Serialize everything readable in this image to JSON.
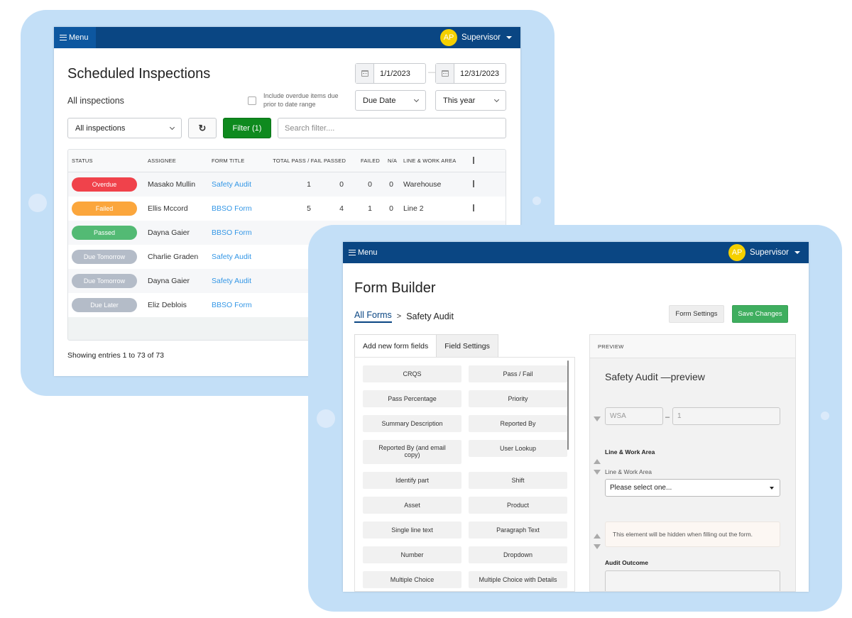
{
  "colors": {
    "frame": "#c3dff7",
    "topbar": "#0a4683",
    "avatar": "#f5d000",
    "link": "#3497e6",
    "filter_button": "#0e8a1e",
    "save_button": "#3fae5f"
  },
  "inspections_screen": {
    "topbar": {
      "menu_icon": "hamburger-icon",
      "menu_label": "Menu",
      "avatar_initials": "AP",
      "user_label": "Supervisor",
      "user_caret_icon": "caret-down-icon"
    },
    "title": "Scheduled Inspections",
    "subtitle": "All inspections",
    "date_range": {
      "start": "1/1/2023",
      "separator": "—",
      "end": "12/31/2023",
      "icon": "calendar-icon"
    },
    "include_overdue": {
      "checked": false,
      "label_line1": "Include overdue items due",
      "label_line2": "prior to date range"
    },
    "date_field_select": "Due Date",
    "period_select": "This year",
    "view_select": "All inspections",
    "refresh_icon": "refresh-icon",
    "filter_label": "Filter (1)",
    "search_placeholder": "Search filter....",
    "table": {
      "columns": [
        "STATUS",
        "ASSIGNEE",
        "FORM TITLE",
        "TOTAL PASS / FAIL",
        "PASSED",
        "FAILED",
        "N/A",
        "LINE & WORK AREA"
      ],
      "rows": [
        {
          "status": "Overdue",
          "status_color": "#f0424b",
          "assignee": "Masako Mullin",
          "form": "Safety Audit",
          "total": "1",
          "passed": "0",
          "failed": "0",
          "na": "0",
          "line": "Warehouse"
        },
        {
          "status": "Failed",
          "status_color": "#fba63c",
          "assignee": "Ellis Mccord",
          "form": "BBSO Form",
          "total": "5",
          "passed": "4",
          "failed": "1",
          "na": "0",
          "line": "Line 2"
        },
        {
          "status": "Passed",
          "status_color": "#53ba74",
          "assignee": "Dayna Gaier",
          "form": "BBSO Form",
          "total": "",
          "passed": "",
          "failed": "",
          "na": "",
          "line": ""
        },
        {
          "status": "Due Tomorrow",
          "status_color": "#b4bcc8",
          "assignee": "Charlie Graden",
          "form": "Safety Audit",
          "total": "",
          "passed": "",
          "failed": "",
          "na": "",
          "line": ""
        },
        {
          "status": "Due Tomorrow",
          "status_color": "#b4bcc8",
          "assignee": "Dayna Gaier",
          "form": "Safety Audit",
          "total": "",
          "passed": "",
          "failed": "",
          "na": "",
          "line": ""
        },
        {
          "status": "Due Later",
          "status_color": "#b4bcc8",
          "assignee": "Eliz Deblois",
          "form": "BBSO Form",
          "total": "",
          "passed": "",
          "failed": "",
          "na": "",
          "line": ""
        }
      ]
    },
    "footer": "Showing entries 1 to 73 of 73"
  },
  "form_builder_screen": {
    "topbar": {
      "menu_label": "Menu",
      "avatar_initials": "AP",
      "user_label": "Supervisor"
    },
    "title": "Form Builder",
    "breadcrumb": {
      "root": "All Forms",
      "separator": ">",
      "current": "Safety Audit"
    },
    "form_settings_label": "Form Settings",
    "save_label": "Save Changes",
    "tabs": [
      {
        "label": "Add new form fields",
        "active": true
      },
      {
        "label": "Field Settings",
        "active": false
      }
    ],
    "field_types": [
      "CRQS",
      "Pass / Fail",
      "Pass Percentage",
      "Priority",
      "Summary Description",
      "Reported By",
      "Reported By (and email copy)",
      "User Lookup",
      "Identify part",
      "Shift",
      "Asset",
      "Product",
      "Single line text",
      "Paragraph Text",
      "Number",
      "Dropdown",
      "Multiple Choice",
      "Multiple Choice with Details"
    ],
    "preview": {
      "header": "PREVIEW",
      "title": "Safety Audit —preview",
      "id_prefix_value": "WSA",
      "id_separator": "–",
      "id_number_value": "1",
      "line_area_heading": "Line & Work Area",
      "line_area_label": "Line & Work Area",
      "line_area_select": "Please select one...",
      "hidden_note": "This element will be hidden when filling out the form.",
      "audit_outcome_label": "Audit Outcome"
    }
  }
}
